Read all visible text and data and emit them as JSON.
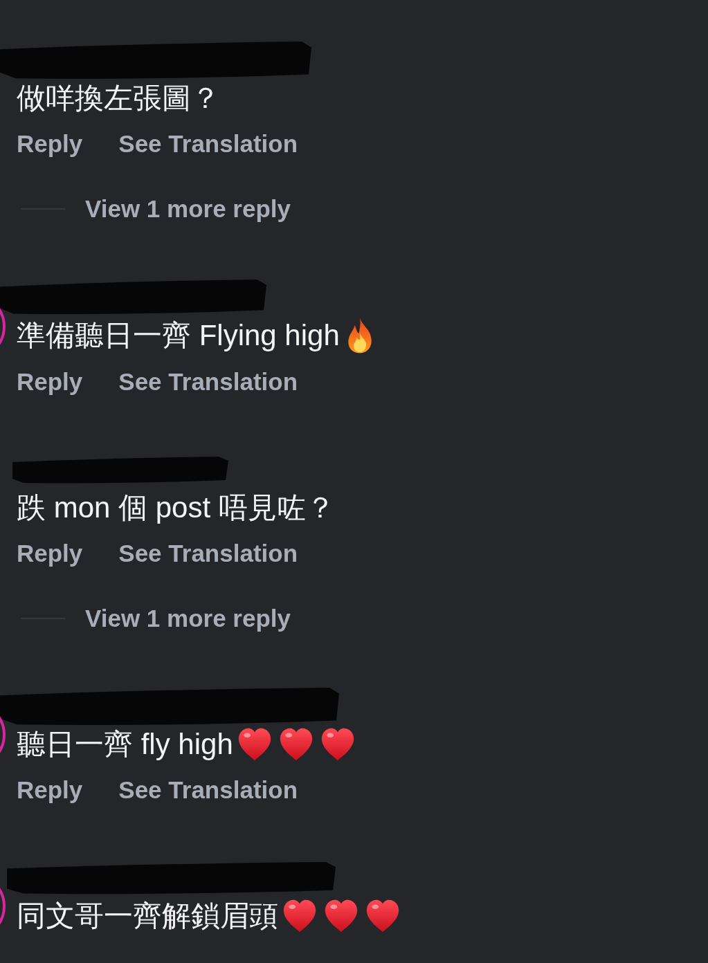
{
  "comments": [
    {
      "name_redacted": true,
      "story_ring": false,
      "text": "做咩換左張圖？",
      "actions": [
        "Reply",
        "See Translation"
      ],
      "more_replies": "View 1 more reply"
    },
    {
      "name_redacted": true,
      "story_ring": true,
      "text": "準備聽日一齊 Flying high",
      "emojis": [
        {
          "kind": "fire"
        }
      ],
      "actions": [
        "Reply",
        "See Translation"
      ]
    },
    {
      "name_redacted": true,
      "story_ring": false,
      "text": "跌 mon 個 post 唔見咗？",
      "actions": [
        "Reply",
        "See Translation"
      ],
      "more_replies": "View 1 more reply"
    },
    {
      "name_redacted": true,
      "story_ring": true,
      "text": "聽日一齊 fly high",
      "emojis": [
        {
          "kind": "heart"
        },
        {
          "kind": "heart"
        },
        {
          "kind": "heart"
        }
      ],
      "actions": [
        "Reply",
        "See Translation"
      ]
    },
    {
      "name_redacted": true,
      "story_ring": true,
      "text": "同文哥一齊解鎖眉頭",
      "emojis": [
        {
          "kind": "heart"
        },
        {
          "kind": "heart"
        },
        {
          "kind": "heart"
        }
      ]
    }
  ]
}
